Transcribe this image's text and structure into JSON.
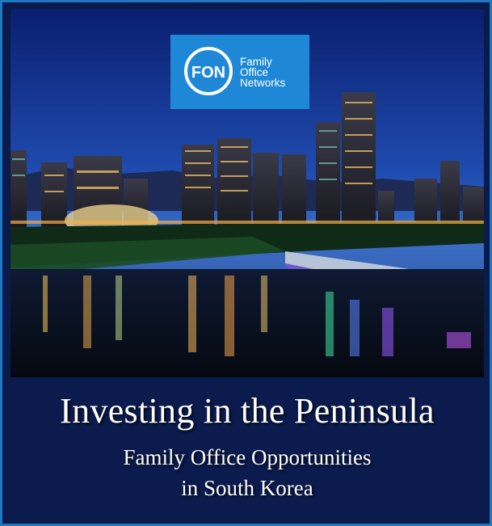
{
  "logo": {
    "monogram": "FON",
    "line1": "Family",
    "line2": "Office",
    "line3": "Networks"
  },
  "photo": {
    "icon": "city-skyline-night-image"
  },
  "caption": {
    "title": "Investing in the Peninsula",
    "subtitle_line1": "Family Office Opportunities",
    "subtitle_line2": "in South Korea"
  },
  "colors": {
    "frame_border": "#1e78c4",
    "logo_bg": "#1e88d6",
    "caption_bg": "#0b1b4d",
    "text": "#ffffff"
  }
}
